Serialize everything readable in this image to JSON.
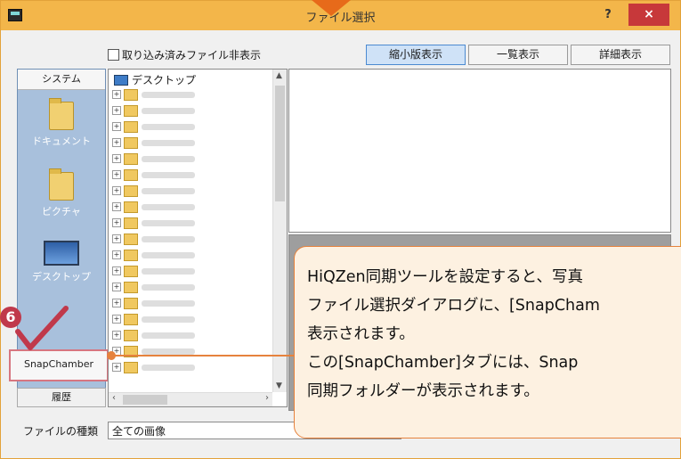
{
  "window": {
    "title": "ファイル選択",
    "help_label": "?",
    "close_label": "×"
  },
  "options": {
    "hide_imported_label": "取り込み済みファイル非表示"
  },
  "view_tabs": {
    "thumbnail": "縮小版表示",
    "list": "一覧表示",
    "detail": "詳細表示",
    "active": "thumbnail"
  },
  "sidebar": {
    "system_tab": "システム",
    "items": [
      {
        "label": "ドキュメント",
        "icon": "folder-icon"
      },
      {
        "label": "ピクチャ",
        "icon": "folder-icon"
      },
      {
        "label": "デスクトップ",
        "icon": "monitor-icon"
      }
    ],
    "snapchamber_label": "SnapChamber",
    "history_tab": "履歴"
  },
  "tree": {
    "root_label": "デスクトップ"
  },
  "file_type": {
    "label": "ファイルの種類",
    "value": "全ての画像"
  },
  "annotation": {
    "step_number": "6",
    "lines": [
      "HiQZen同期ツールを設定すると、写真",
      "ファイル選択ダイアログに、[SnapCham",
      "表示されます。",
      "この[SnapChamber]タブには、Snap",
      "同期フォルダーが表示されます。"
    ]
  },
  "colors": {
    "titlebar": "#f3b64a",
    "close": "#c7383a",
    "accent": "#e6823d",
    "badge": "#c0394b",
    "sidebar": "#a8c0dc"
  }
}
